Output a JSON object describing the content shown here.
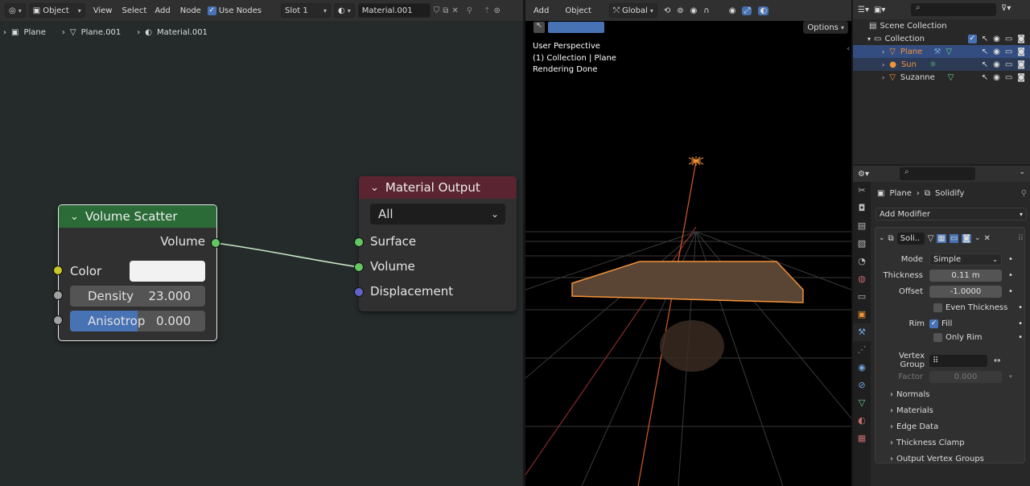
{
  "node_header": {
    "object_mode": "Object",
    "menus": [
      "View",
      "Select",
      "Add",
      "Node"
    ],
    "use_nodes_label": "Use Nodes",
    "slot": "Slot 1",
    "material_name": "Material.001"
  },
  "breadcrumb": {
    "items": [
      "Plane",
      "Plane.001",
      "Material.001"
    ]
  },
  "volume_scatter": {
    "title": "Volume Scatter",
    "output_label": "Volume",
    "color_label": "Color",
    "density_label": "Density",
    "density_value": "23.000",
    "anisotropy_label": "Anisotrop",
    "anisotropy_value": "0.000",
    "anisotropy_fraction": 0.5
  },
  "material_output": {
    "title": "Material Output",
    "target": "All",
    "inputs": [
      "Surface",
      "Volume",
      "Displacement"
    ]
  },
  "viewport": {
    "menus": [
      "Add",
      "Object"
    ],
    "orientation": "Global",
    "options_label": "Options",
    "overlay_lines": [
      "User Perspective",
      "(1) Collection | Plane",
      "Rendering Done"
    ]
  },
  "outliner": {
    "scene_collection": "Scene Collection",
    "collection": "Collection",
    "objects": [
      "Plane",
      "Sun",
      "Suzanne"
    ]
  },
  "properties": {
    "object_name": "Plane",
    "modifier_name": "Solidify",
    "add_modifier_label": "Add Modifier",
    "modifier_short": "Soli..",
    "mode_label": "Mode",
    "mode_value": "Simple",
    "thickness_label": "Thickness",
    "thickness_value": "0.11 m",
    "offset_label": "Offset",
    "offset_value": "-1.0000",
    "even_thickness_label": "Even Thickness",
    "rim_label": "Rim",
    "fill_label": "Fill",
    "only_rim_label": "Only Rim",
    "vertex_group_label": "Vertex Group",
    "factor_label": "Factor",
    "factor_value": "0.000",
    "subpanels": [
      "Normals",
      "Materials",
      "Edge Data",
      "Thickness Clamp",
      "Output Vertex Groups"
    ]
  },
  "colors": {
    "selection_orange": "#f29339",
    "node_scatter_header": "#2a6b37",
    "node_output_header": "#5a2430",
    "socket_green": "#63c763",
    "socket_yellow": "#c7c729",
    "socket_gray": "#a1a1a1",
    "socket_purple": "#6363c7",
    "active_blue": "#4772b3"
  }
}
